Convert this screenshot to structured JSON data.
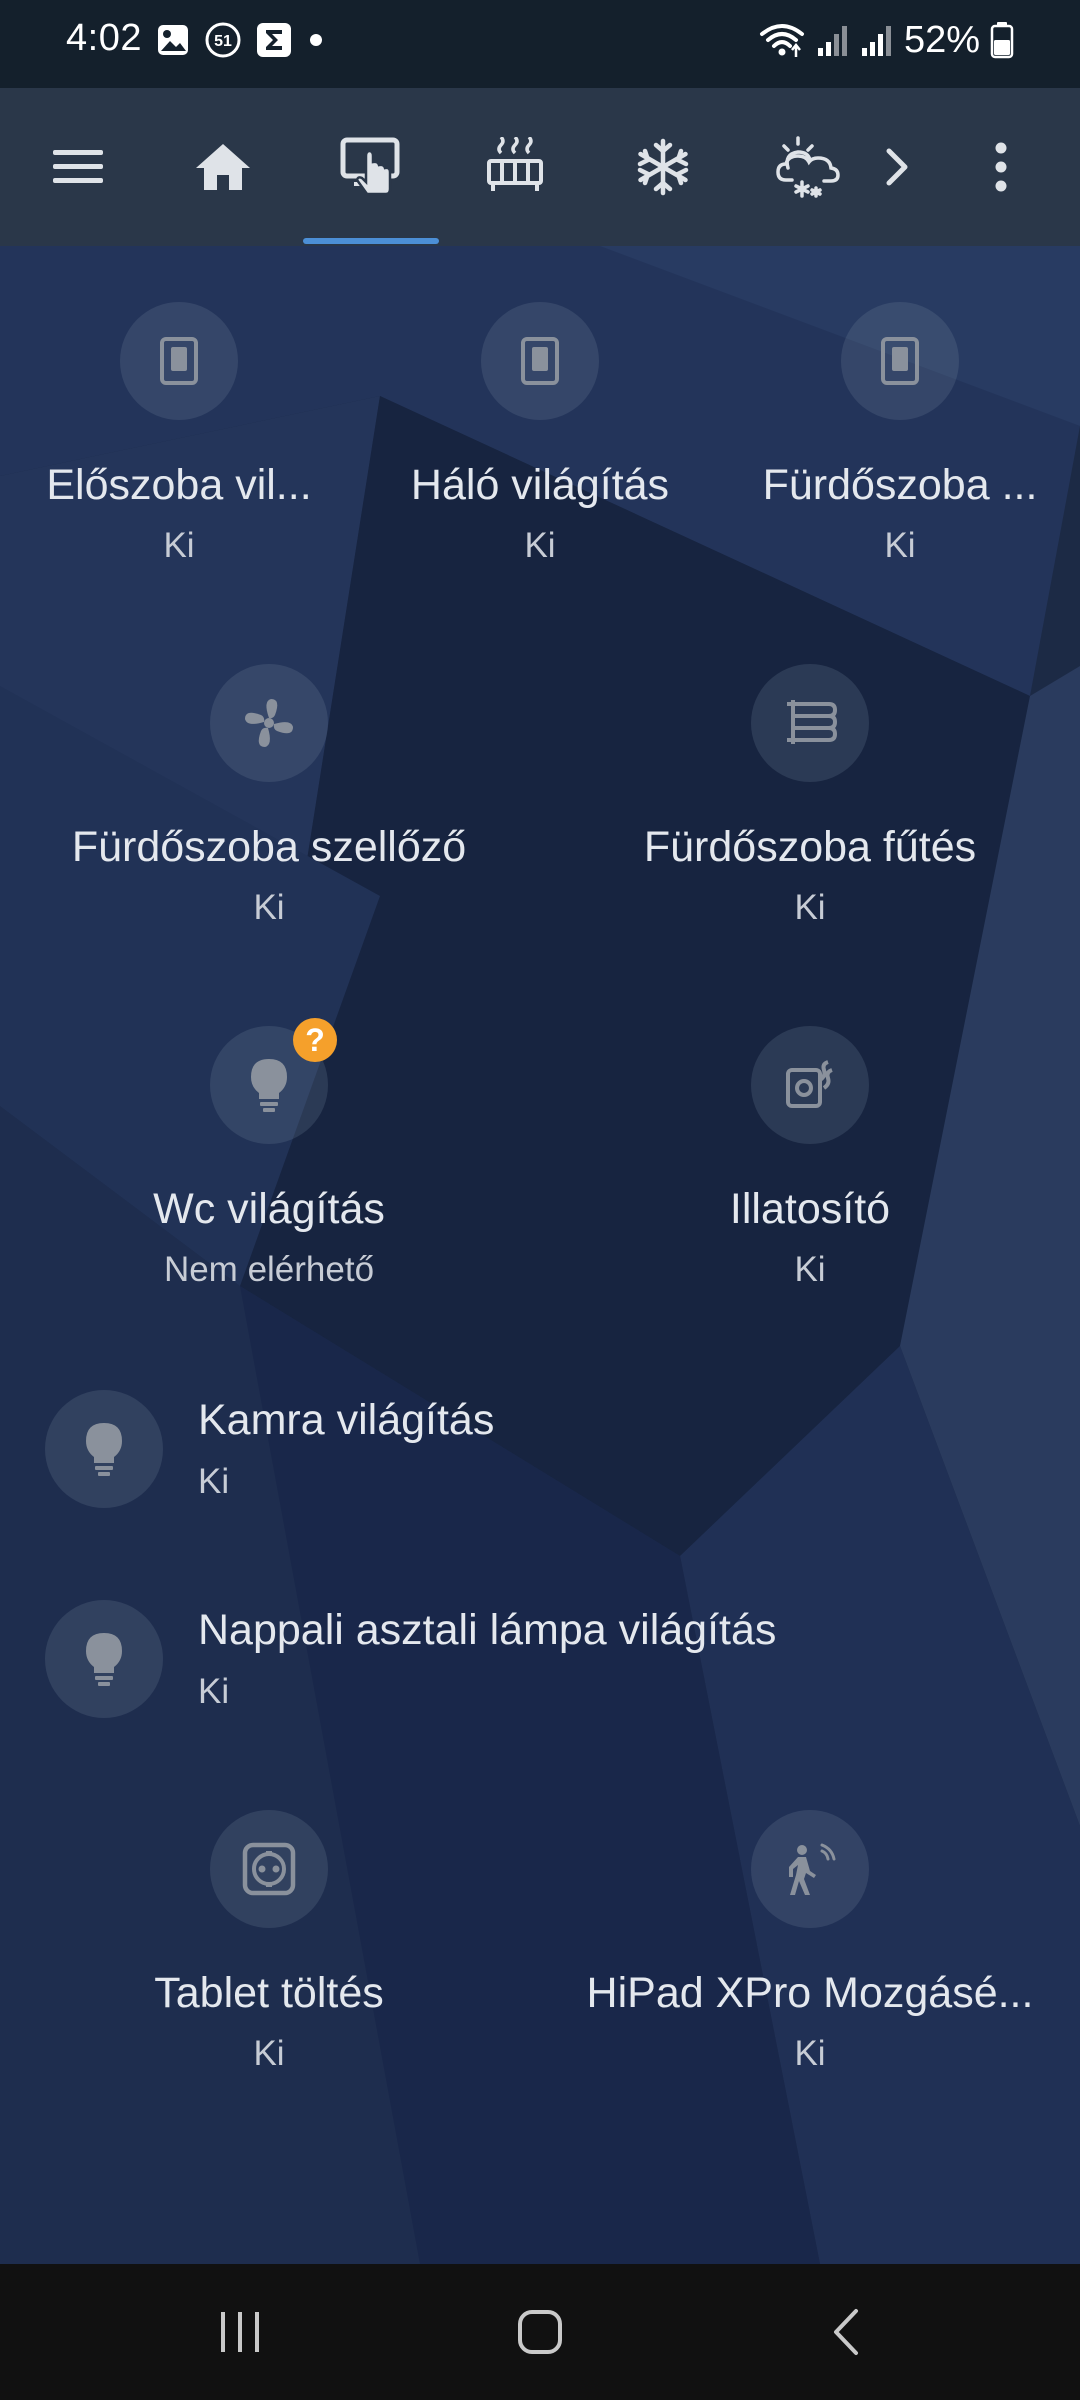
{
  "status_bar": {
    "time": "4:02",
    "notification_badge": "51",
    "battery_percent": "52%",
    "icons": [
      "gallery-icon",
      "notification-count-icon",
      "sigma-app-icon",
      "dot-icon",
      "wifi-icon",
      "signal-icon",
      "signal-icon",
      "battery-icon"
    ]
  },
  "toolbar": {
    "menu_icon": "hamburger-menu-icon",
    "tabs": [
      {
        "icon": "home-icon",
        "selected": false
      },
      {
        "icon": "touch-monitor-icon",
        "selected": true
      },
      {
        "icon": "radiator-icon",
        "selected": false
      },
      {
        "icon": "snowflake-icon",
        "selected": false
      },
      {
        "icon": "weather-snowy-icon",
        "selected": false
      }
    ],
    "more_tabs_icon": "chevron-right-icon",
    "overflow_icon": "more-vertical-icon",
    "accent_color": "#4c8fd6"
  },
  "tiles": [
    {
      "name": "Előszoba vil...",
      "state": "Ki",
      "icon": "light-switch-icon"
    },
    {
      "name": "Háló világítás",
      "state": "Ki",
      "icon": "light-switch-icon"
    },
    {
      "name": "Fürdőszoba ...",
      "state": "Ki",
      "icon": "light-switch-icon"
    },
    {
      "name": "Fürdőszoba szellőző",
      "state": "Ki",
      "icon": "fan-icon"
    },
    {
      "name": "Fürdőszoba fűtés",
      "state": "Ki",
      "icon": "heater-icon"
    },
    {
      "name": "Wc világítás",
      "state": "Nem elérhető",
      "icon": "lightbulb-icon",
      "badge": "?"
    },
    {
      "name": "Illatosító",
      "state": "Ki",
      "icon": "diffuser-icon"
    },
    {
      "name": "Kamra világítás",
      "state": "Ki",
      "icon": "lightbulb-icon"
    },
    {
      "name": "Nappali asztali lámpa világítás",
      "state": "Ki",
      "icon": "lightbulb-icon"
    },
    {
      "name": "Tablet töltés",
      "state": "Ki",
      "icon": "power-socket-icon"
    },
    {
      "name": "HiPad XPro Mozgásé...",
      "state": "Ki",
      "icon": "motion-sensor-icon"
    }
  ],
  "badge_color": "#f5a02b",
  "nav_bar": {
    "icons": [
      "recent-apps-icon",
      "home-button-icon",
      "back-icon"
    ]
  }
}
